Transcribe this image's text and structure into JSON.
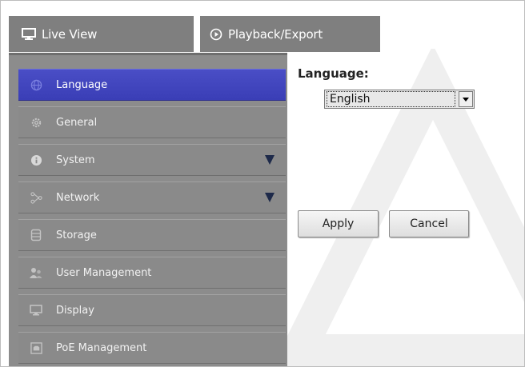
{
  "tabs": {
    "live_view": "Live View",
    "playback_export": "Playback/Export"
  },
  "sidebar": {
    "items": [
      {
        "label": "Language",
        "icon": "globe-icon",
        "active": true
      },
      {
        "label": "General",
        "icon": "gear-icon"
      },
      {
        "label": "System",
        "icon": "info-icon",
        "expandable": true
      },
      {
        "label": "Network",
        "icon": "network-icon",
        "expandable": true
      },
      {
        "label": "Storage",
        "icon": "database-icon"
      },
      {
        "label": "User Management",
        "icon": "users-icon"
      },
      {
        "label": "Display",
        "icon": "monitor-icon"
      },
      {
        "label": "PoE Management",
        "icon": "poe-icon"
      }
    ]
  },
  "settings": {
    "language_label": "Language:",
    "language_value": "English",
    "apply_label": "Apply",
    "cancel_label": "Cancel"
  },
  "colors": {
    "active_item": "#3f43bb",
    "sidebar_bg": "#8c8c8c",
    "tab_bg": "#7f7f7f"
  }
}
